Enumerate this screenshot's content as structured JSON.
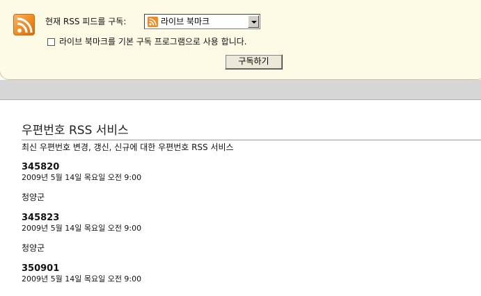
{
  "subscribe_panel": {
    "label": "현재 RSS 피드를 구독:",
    "select_value": "라이브 북마크",
    "checkbox_label": "라이브 북마크를 기본 구독 프로그램으로 사용 합니다.",
    "checkbox_checked": false,
    "button_label": "구독하기"
  },
  "feed": {
    "title": "우편번호 RSS 서비스",
    "subtitle": "최신 우편번호 변경, 갱신, 신규에 대한 우편번호 RSS 서비스",
    "entries": [
      {
        "title": "345820",
        "date": "2009년 5월 14일 목요일 오전 9:00",
        "body": "청양군"
      },
      {
        "title": "345823",
        "date": "2009년 5월 14일 목요일 오전 9:00",
        "body": "청양군"
      },
      {
        "title": "350901",
        "date": "2009년 5월 14일 목요일 오전 9:00",
        "body": ""
      }
    ]
  },
  "colors": {
    "panel_bg": "#fdfbe6",
    "rss_orange": "#f28a1e",
    "band_gray": "#d6d6d6"
  },
  "icons": [
    "rss-feed-icon",
    "rss-small-icon",
    "dropdown-arrow-icon"
  ]
}
